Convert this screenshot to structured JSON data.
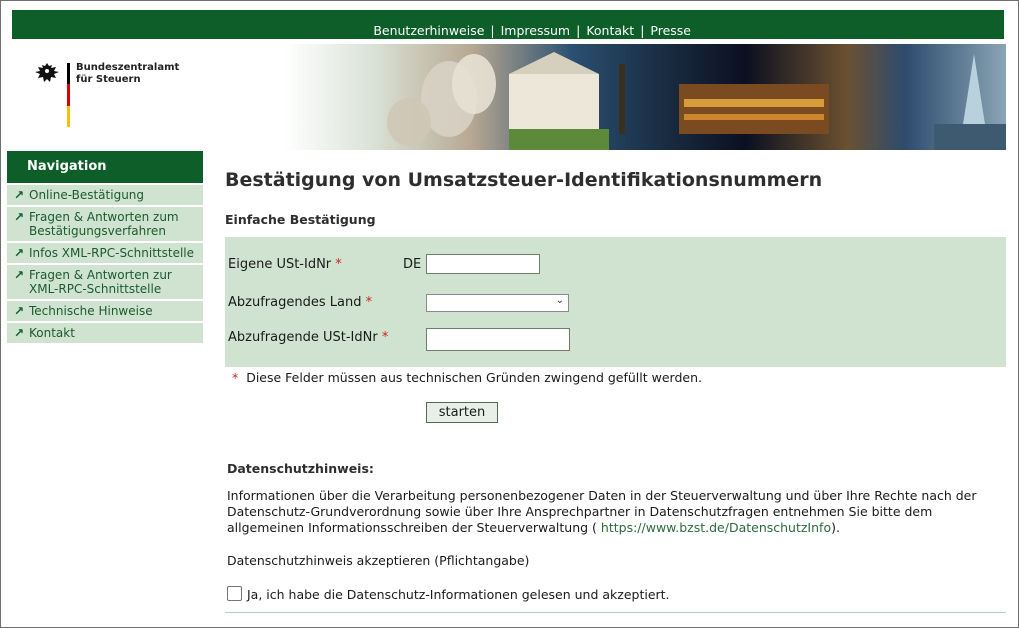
{
  "top_links": [
    "Benutzerhinweise",
    "Impressum",
    "Kontakt",
    "Presse"
  ],
  "top_separator": "|",
  "logo": {
    "line1": "Bundeszentralamt",
    "line2": "für Steuern"
  },
  "nav": {
    "heading": "Navigation",
    "items": [
      {
        "label": "Online-Bestätigung"
      },
      {
        "label": "Fragen & Antworten zum Bestätigungsverfahren"
      },
      {
        "label": "Infos XML-RPC-Schnittstelle"
      },
      {
        "label": "Fragen & Antworten zur XML-RPC-Schnittstelle"
      },
      {
        "label": "Technische Hinweise"
      },
      {
        "label": "Kontakt"
      }
    ]
  },
  "page_title": "Bestätigung von Umsatzsteuer-Identifikationsnummern",
  "section_title": "Einfache Bestätigung",
  "form": {
    "own_vat_label": "Eigene USt-IdNr",
    "own_vat_prefix": "DE",
    "own_vat_value": "",
    "country_label": "Abzufragendes Land",
    "country_selected": "",
    "query_vat_label": "Abzufragende USt-IdNr",
    "query_vat_value": "",
    "required_marker": "*"
  },
  "required_note": "Diese Felder müssen aus technischen Gründen zwingend gefüllt werden.",
  "submit_label": "starten",
  "privacy": {
    "title": "Datenschutzhinweis:",
    "text_before_link": "Informationen über die Verarbeitung personenbezogener Daten in der Steuerverwaltung und über Ihre Rechte nach der Datenschutz-Grundverordnung sowie über Ihre Ansprechpartner in Datenschutzfragen entnehmen Sie bitte dem allgemeinen Informationsschreiben der Steuerverwaltung ( ",
    "link_text": "https://www.bzst.de/DatenschutzInfo",
    "text_after_link": ").",
    "accept_label": "Datenschutzhinweis akzeptieren (Pflichtangabe)",
    "checkbox_label": "Ja, ich habe die Datenschutz-Informationen gelesen und akzeptiert.",
    "checkbox_checked": false
  },
  "colors": {
    "brand_green": "#0e5e2a",
    "panel_green": "#cfe3d0",
    "required_red": "#d21f1f"
  }
}
